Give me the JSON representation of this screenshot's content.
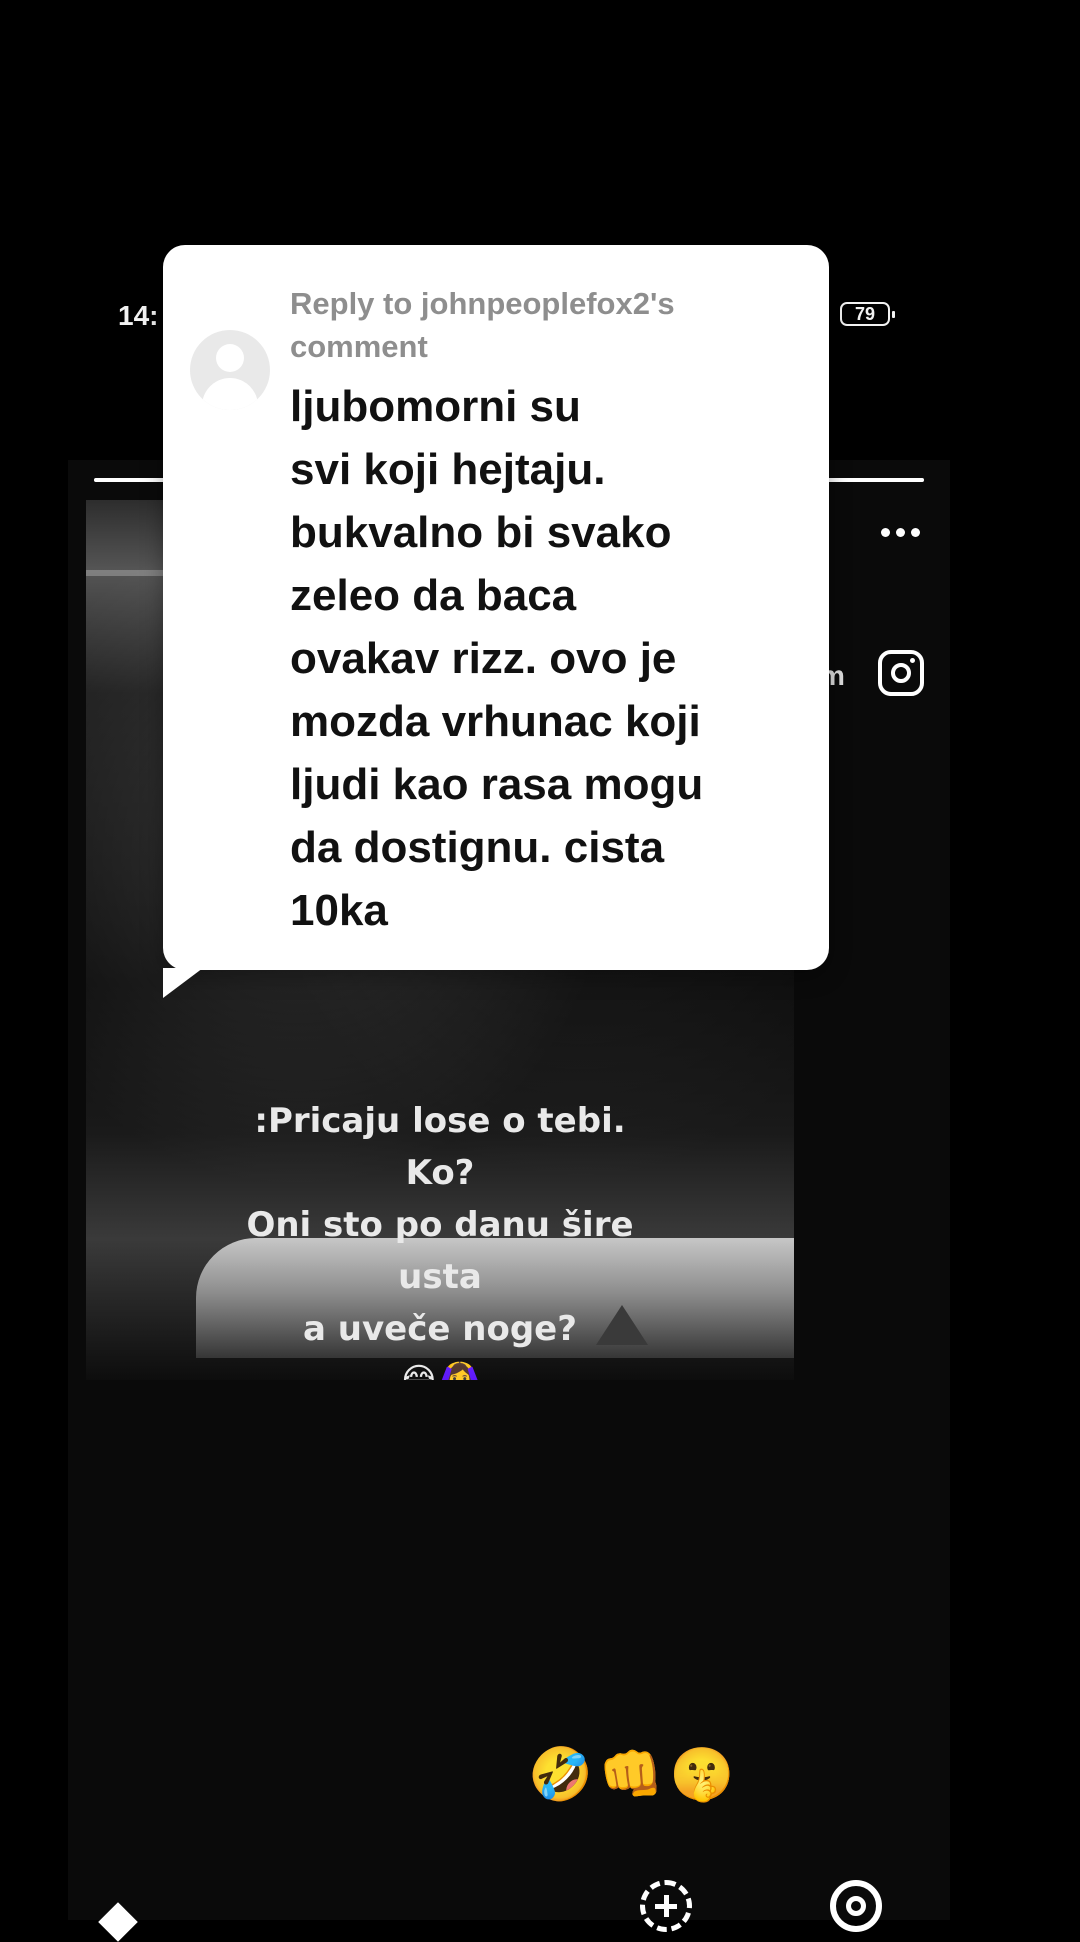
{
  "status_bar": {
    "time": "14:",
    "battery": "79"
  },
  "story": {
    "progress": 1.0,
    "username_tail": "m",
    "video_caption_lines": [
      ":Pricaju lose o tebi.",
      "Ko?",
      "Oni sto po danu šire",
      "usta",
      "a uveče noge?",
      "😂🙆‍♀️"
    ],
    "reaction_emojis": [
      "🤣",
      "👊",
      "🤫"
    ]
  },
  "reply_card": {
    "header_lines": [
      "Reply to johnpeoplefox2's",
      "comment"
    ],
    "body_lines": [
      "ljubomorni su",
      "svi koji hejtaju.",
      "bukvalno bi svako",
      "zeleo da baca",
      "ovakav rizz. ovo je",
      "mozda vrhunac koji",
      "ljudi kao rasa mogu",
      "da dostignu. cista",
      "10ka"
    ]
  },
  "icons": {
    "more": "more-icon",
    "instagram": "instagram-icon",
    "create": "create-icon",
    "threads": "threads-icon",
    "home": "home-icon"
  }
}
